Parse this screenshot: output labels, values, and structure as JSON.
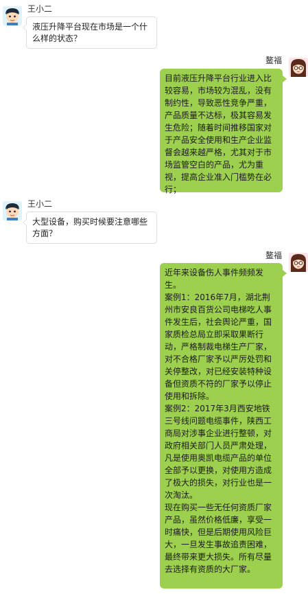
{
  "messages": [
    {
      "sender": "王小二",
      "side": "left",
      "avatar_icon": "boy-avatar-icon",
      "lines": [
        "液压升降平台现在市场是一个什么样的状态？"
      ]
    },
    {
      "sender": "鳌福",
      "side": "right",
      "avatar_icon": "girl-avatar-icon",
      "lines": [
        "目前液压升降平台行业进入比较容易，市场较为混乱，没有制约性，导致恶性竞争严重，产品质量不达标，极其容易发生危险；随着时间推移国家对于产品安全使用和生产企业监督会越来越严格，尤其对于市场监管空白的产品，尤为重视，提高企业准入门槛势在必行；"
      ]
    },
    {
      "sender": "王小二",
      "side": "left",
      "avatar_icon": "boy-avatar-icon",
      "lines": [
        "大型设备，购买时候要注意哪些方面？"
      ]
    },
    {
      "sender": "鳌福",
      "side": "right",
      "avatar_icon": "girl-avatar-icon",
      "lines": [
        "近年来设备伤人事件频频发生。",
        "案例1：2016年7月，湖北荆州市安良百货公司电梯吃人事件发生后，社会舆论严重，国家质检总局立即采取果断行动，严格制裁电梯生产厂家，对不合格厂家予以严厉处罚和关停整改，对已经安装特种设备但资质不符的厂家予以停止使用和拆除。",
        "案例2：2017年3月西安地铁三号线问题电缆事件，陕西工商局对涉事企业进行整顿，对政府相关部门人员严肃处理，凡是使用奥凯电缆产品的单位全部予以更换，对使用方造成了极大的损失，对行业也是一次淘汰。",
        "现在购买一些无任何资质厂家产品，虽然价格低廉，享受一时痛快，但是后期使用风险巨大，一旦发生事故追责困难，最终带来更大损失。所有尽量去选择有资质的大厂家。"
      ]
    }
  ],
  "colors": {
    "right_bubble": "#9ed04f",
    "left_bubble_border": "#dcdcdc"
  }
}
